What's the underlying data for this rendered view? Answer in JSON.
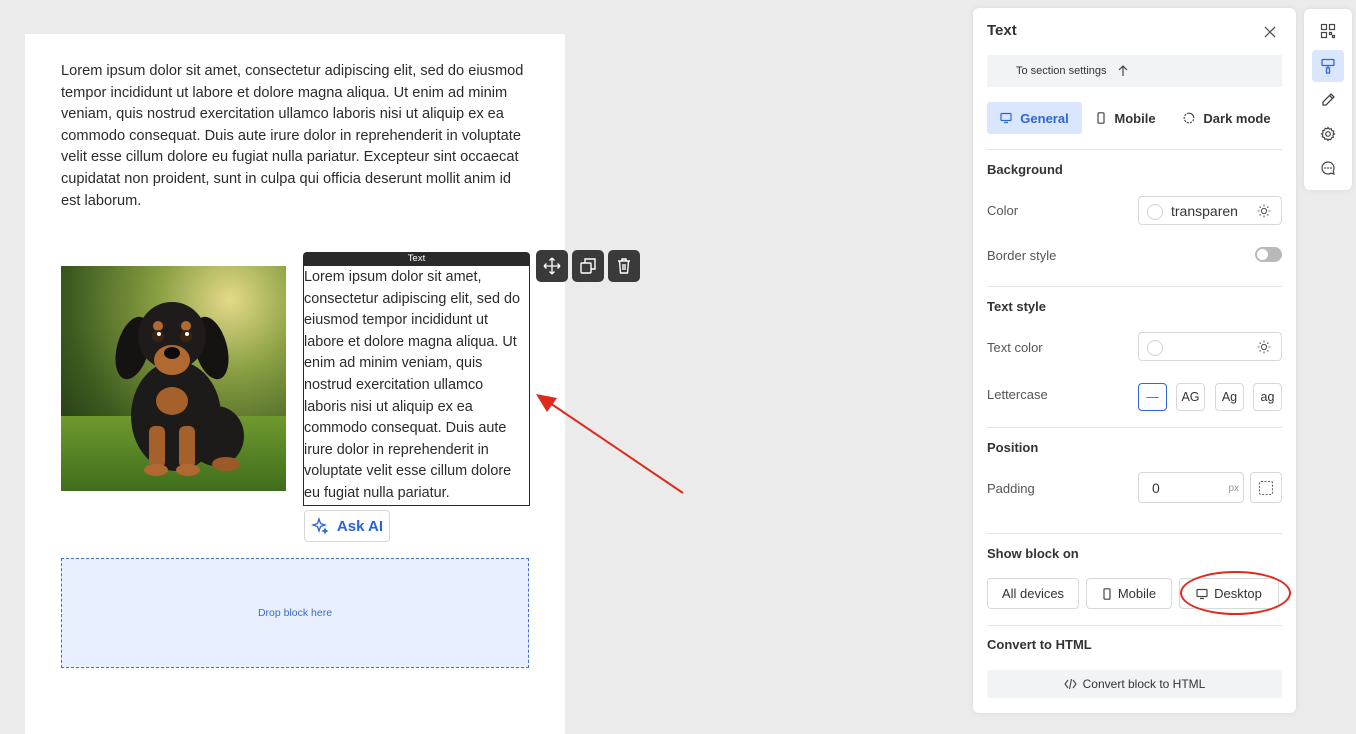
{
  "canvas": {
    "paragraph1": "Lorem ipsum dolor sit amet, consectetur adipiscing elit, sed do eiusmod tempor incididunt ut labore et dolore magna aliqua. Ut enim ad minim veniam, quis nostrud exercitation ullamco laboris nisi ut aliquip ex ea commodo consequat. Duis aute irure dolor in reprehenderit in voluptate velit esse cillum dolore eu fugiat nulla pariatur. Excepteur sint occaecat cupidatat non proident, sunt in culpa qui officia deserunt mollit anim id est laborum.",
    "text_block_tab": "Text",
    "text_block_content": "Lorem ipsum dolor sit amet,\nconsectetur adipiscing elit, sed do\neiusmod tempor incididunt ut\nlabore et dolore magna aliqua. Ut\nenim ad minim veniam, quis\nnostrud exercitation ullamco\nlaboris nisi ut aliquip ex ea\ncommodo consequat. Duis aute\nirure dolor in reprehenderit in\nvoluptate velit esse cillum dolore\neu fugiat nulla pariatur.",
    "ask_ai_label": "Ask AI",
    "drop_zone_label": "Drop block here",
    "toolbar_icons": [
      "move-icon",
      "duplicate-icon",
      "trash-icon"
    ]
  },
  "panel": {
    "title": "Text",
    "to_section_label": "To section settings",
    "tabs": [
      {
        "label": "General",
        "icon": "desktop-icon",
        "active": true
      },
      {
        "label": "Mobile",
        "icon": "mobile-icon",
        "active": false
      },
      {
        "label": "Dark mode",
        "icon": "dark-mode-icon",
        "active": false
      }
    ],
    "background": {
      "title": "Background",
      "color_label": "Color",
      "color_value": "transparen",
      "border_style_label": "Border style"
    },
    "text_style": {
      "title": "Text style",
      "text_color_label": "Text color",
      "text_color_value": "",
      "lettercase_label": "Lettercase",
      "lettercase_options": [
        "—",
        "AG",
        "Ag",
        "ag"
      ]
    },
    "position": {
      "title": "Position",
      "padding_label": "Padding",
      "padding_value": "0",
      "padding_unit": "px"
    },
    "show_block_on": {
      "title": "Show block on",
      "options": [
        "All devices",
        "Mobile",
        "Desktop"
      ]
    },
    "convert": {
      "title": "Convert to HTML",
      "button_label": "Convert block to HTML"
    }
  },
  "colors": {
    "accent": "#2d67d6",
    "accent_bg": "#d9e6fd",
    "annotation_red": "#e0291d"
  }
}
